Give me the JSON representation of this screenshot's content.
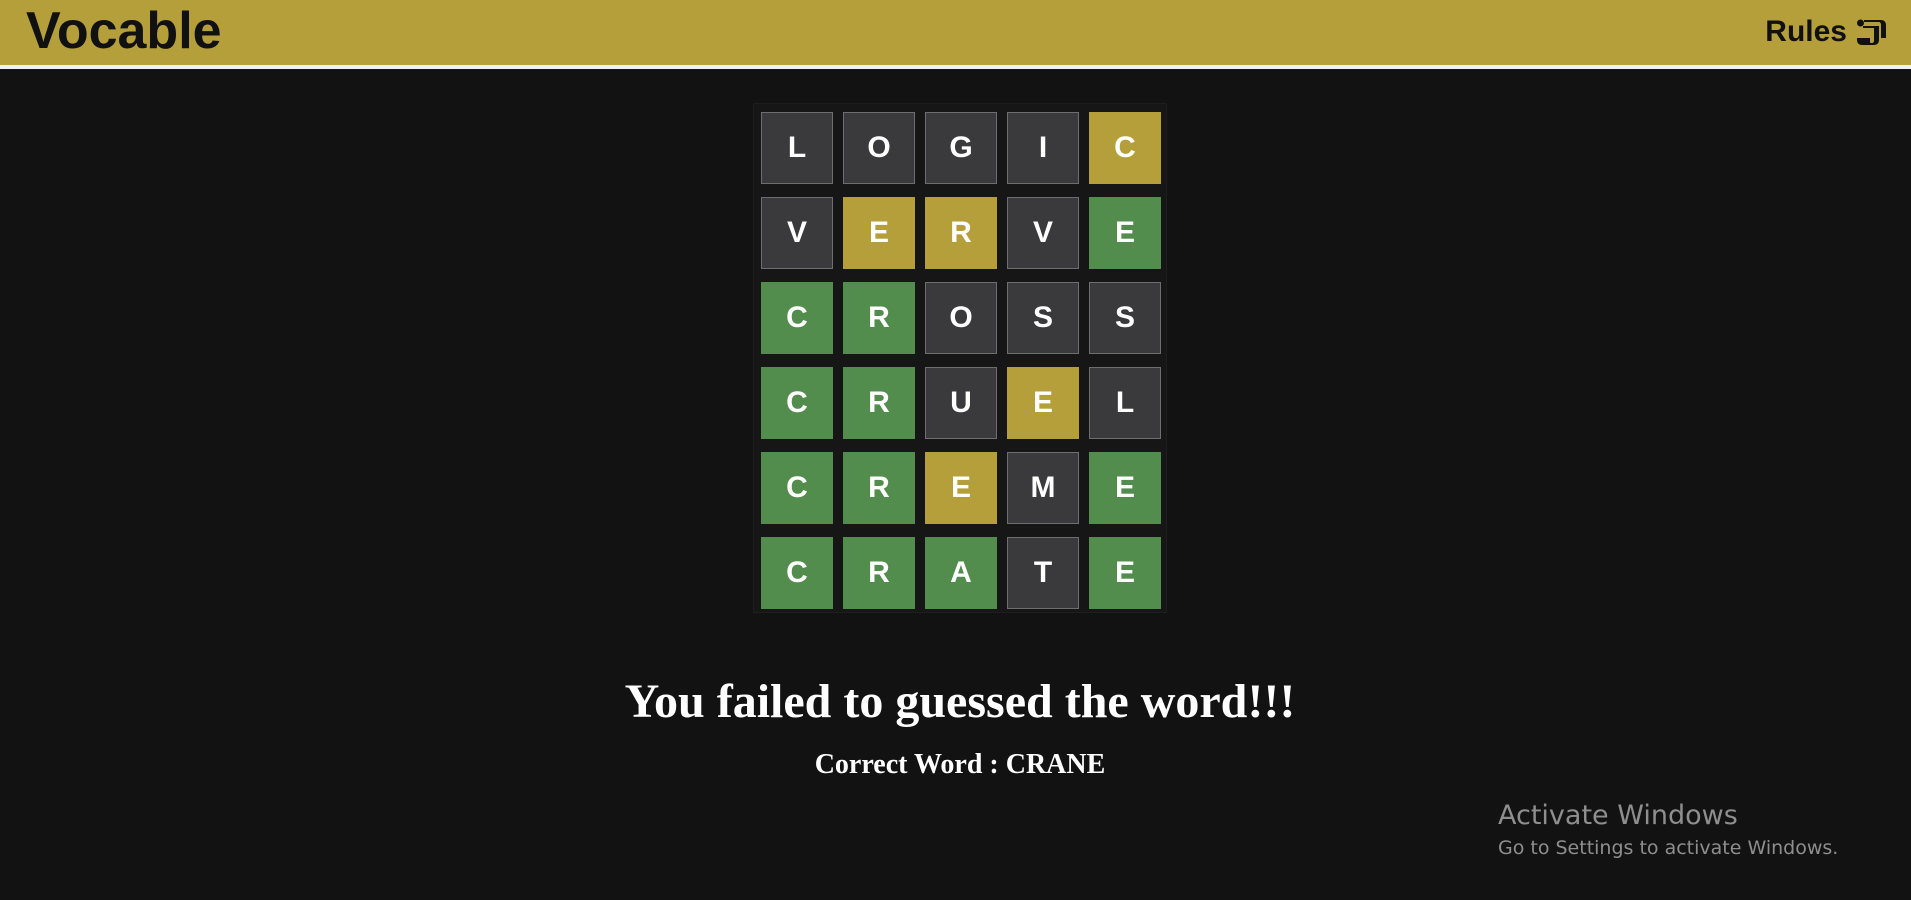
{
  "header": {
    "title": "Vocable",
    "rules_label": "Rules",
    "rules_icon": "scroll-icon",
    "background_color": "#b59f3b"
  },
  "board": {
    "rows": [
      [
        {
          "letter": "L",
          "state": "absent"
        },
        {
          "letter": "O",
          "state": "absent"
        },
        {
          "letter": "G",
          "state": "absent"
        },
        {
          "letter": "I",
          "state": "absent"
        },
        {
          "letter": "C",
          "state": "present"
        }
      ],
      [
        {
          "letter": "V",
          "state": "absent"
        },
        {
          "letter": "E",
          "state": "present"
        },
        {
          "letter": "R",
          "state": "present"
        },
        {
          "letter": "V",
          "state": "absent"
        },
        {
          "letter": "E",
          "state": "correct"
        }
      ],
      [
        {
          "letter": "C",
          "state": "correct"
        },
        {
          "letter": "R",
          "state": "correct"
        },
        {
          "letter": "O",
          "state": "absent"
        },
        {
          "letter": "S",
          "state": "absent"
        },
        {
          "letter": "S",
          "state": "absent"
        }
      ],
      [
        {
          "letter": "C",
          "state": "correct"
        },
        {
          "letter": "R",
          "state": "correct"
        },
        {
          "letter": "U",
          "state": "absent"
        },
        {
          "letter": "E",
          "state": "present"
        },
        {
          "letter": "L",
          "state": "absent"
        }
      ],
      [
        {
          "letter": "C",
          "state": "correct"
        },
        {
          "letter": "R",
          "state": "correct"
        },
        {
          "letter": "E",
          "state": "present"
        },
        {
          "letter": "M",
          "state": "absent"
        },
        {
          "letter": "E",
          "state": "correct"
        }
      ],
      [
        {
          "letter": "C",
          "state": "correct"
        },
        {
          "letter": "R",
          "state": "correct"
        },
        {
          "letter": "A",
          "state": "correct"
        },
        {
          "letter": "T",
          "state": "absent"
        },
        {
          "letter": "E",
          "state": "correct"
        }
      ]
    ],
    "colors": {
      "absent": "#3a3a3c",
      "present": "#b59f3b",
      "correct": "#538d4e"
    }
  },
  "result": {
    "message": "You failed to guessed the word!!!",
    "correct_word_line": "Correct Word : CRANE"
  },
  "watermark": {
    "title": "Activate Windows",
    "subtitle": "Go to Settings to activate Windows."
  }
}
